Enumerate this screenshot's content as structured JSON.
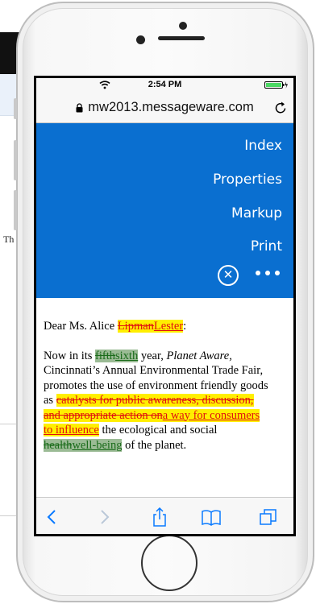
{
  "status_bar": {
    "time": "2:54 PM"
  },
  "address_bar": {
    "url": "mw2013.messageware.com"
  },
  "menu": {
    "items": [
      "Index",
      "Properties",
      "Markup",
      "Print"
    ],
    "close_glyph": "✕"
  },
  "background": {
    "snippet": "Th"
  },
  "document": {
    "greeting": {
      "prefix": "Dear Ms. Alice ",
      "deleted": "Lipman",
      "inserted": "Lester",
      "suffix": ":"
    },
    "line1": {
      "prefix": "Now in its ",
      "deleted": "fifth",
      "inserted": "sixth",
      "mid": " year, ",
      "italic": "Planet Aware,",
      "suffix": ""
    },
    "line2": "Cincinnati’s Annual Environmental Trade Fair,",
    "line3": "promotes the use of environment friendly goods",
    "line4": {
      "prefix": "as ",
      "deleted": "catalysts for public awareness, discussion,"
    },
    "line5": {
      "deleted": "and appropriate action on",
      "inserted": "a way for consumers"
    },
    "line6": {
      "inserted": "to influence",
      "suffix": " the ecological and social"
    },
    "line7": {
      "deleted": "health",
      "inserted": "well-being",
      "suffix": " of the planet."
    }
  },
  "icons": [
    "wifi-icon",
    "battery-icon",
    "lock-icon",
    "reload-icon",
    "back-icon",
    "forward-icon",
    "share-icon",
    "bookmarks-icon",
    "tabs-icon"
  ],
  "colors": {
    "menu_blue": "#0a6fd0",
    "highlight_yellow": "#ffef00",
    "highlight_green": "#9bbb95",
    "deletion_red": "#e01010",
    "battery_green": "#4cd964"
  }
}
